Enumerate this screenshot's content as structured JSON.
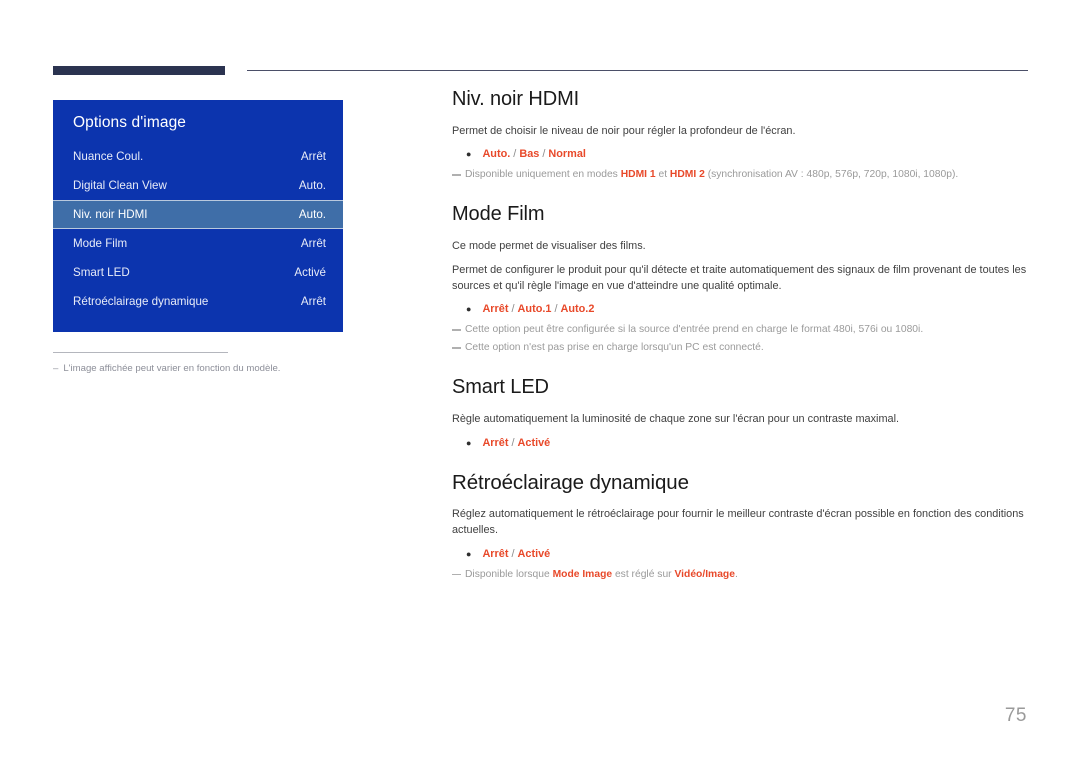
{
  "page": {
    "number": "75"
  },
  "osd": {
    "title": "Options d'image",
    "rows": [
      {
        "label": "Nuance Coul.",
        "value": "Arrêt",
        "selected": false
      },
      {
        "label": "Digital Clean View",
        "value": "Auto.",
        "selected": false
      },
      {
        "label": "Niv. noir HDMI",
        "value": "Auto.",
        "selected": true
      },
      {
        "label": "Mode Film",
        "value": "Arrêt",
        "selected": false
      },
      {
        "label": "Smart LED",
        "value": "Activé",
        "selected": false
      },
      {
        "label": "Rétroéclairage dynamique",
        "value": "Arrêt",
        "selected": false
      }
    ]
  },
  "footnote": {
    "dash": "–",
    "text": "L'image affichée peut varier en fonction du modèle."
  },
  "sections": {
    "hdmi_black": {
      "heading": "Niv. noir HDMI",
      "para1": "Permet de choisir le niveau de noir pour régler la profondeur de l'écran.",
      "options": {
        "a": "Auto.",
        "sep1": " / ",
        "b": "Bas",
        "sep2": " / ",
        "c": "Normal"
      },
      "note1": {
        "pre": "Disponible uniquement en modes ",
        "hl1": "HDMI 1",
        "mid": " et ",
        "hl2": "HDMI 2",
        "post": " (synchronisation AV : 480p, 576p, 720p, 1080i, 1080p)."
      }
    },
    "film_mode": {
      "heading": "Mode Film",
      "para1": "Ce mode permet de visualiser des films.",
      "para2": "Permet de configurer le produit pour qu'il détecte et traite automatiquement des signaux de film provenant de toutes les sources et qu'il règle l'image en vue d'atteindre une qualité optimale.",
      "options": {
        "a": "Arrêt",
        "sep1": " / ",
        "b": "Auto.1",
        "sep2": " / ",
        "c": "Auto.2"
      },
      "note1": "Cette option peut être configurée si la source d'entrée prend en charge le format 480i, 576i ou 1080i.",
      "note2": "Cette option n'est pas prise en charge lorsqu'un PC est connecté."
    },
    "smart_led": {
      "heading": "Smart LED",
      "para1": "Règle automatiquement la luminosité de chaque zone sur l'écran pour un contraste maximal.",
      "options": {
        "a": "Arrêt",
        "sep1": " / ",
        "b": "Activé"
      }
    },
    "dynamic_backlight": {
      "heading": "Rétroéclairage dynamique",
      "para1": "Réglez automatiquement le rétroéclairage pour fournir le meilleur contraste d'écran possible en fonction des conditions actuelles.",
      "options": {
        "a": "Arrêt",
        "sep1": " / ",
        "b": "Activé"
      },
      "note1": {
        "pre": "Disponible lorsque ",
        "hl1": "Mode Image",
        "mid": " est réglé sur ",
        "hl2": "Vidéo/Image",
        "post": "."
      }
    }
  },
  "colors": {
    "osd_blue": "#0c34ae",
    "osd_selected": "#3f6ea8",
    "accent_red": "#e8492a",
    "rule_navy": "#2b3350",
    "note_gray": "#9a9a9a"
  }
}
